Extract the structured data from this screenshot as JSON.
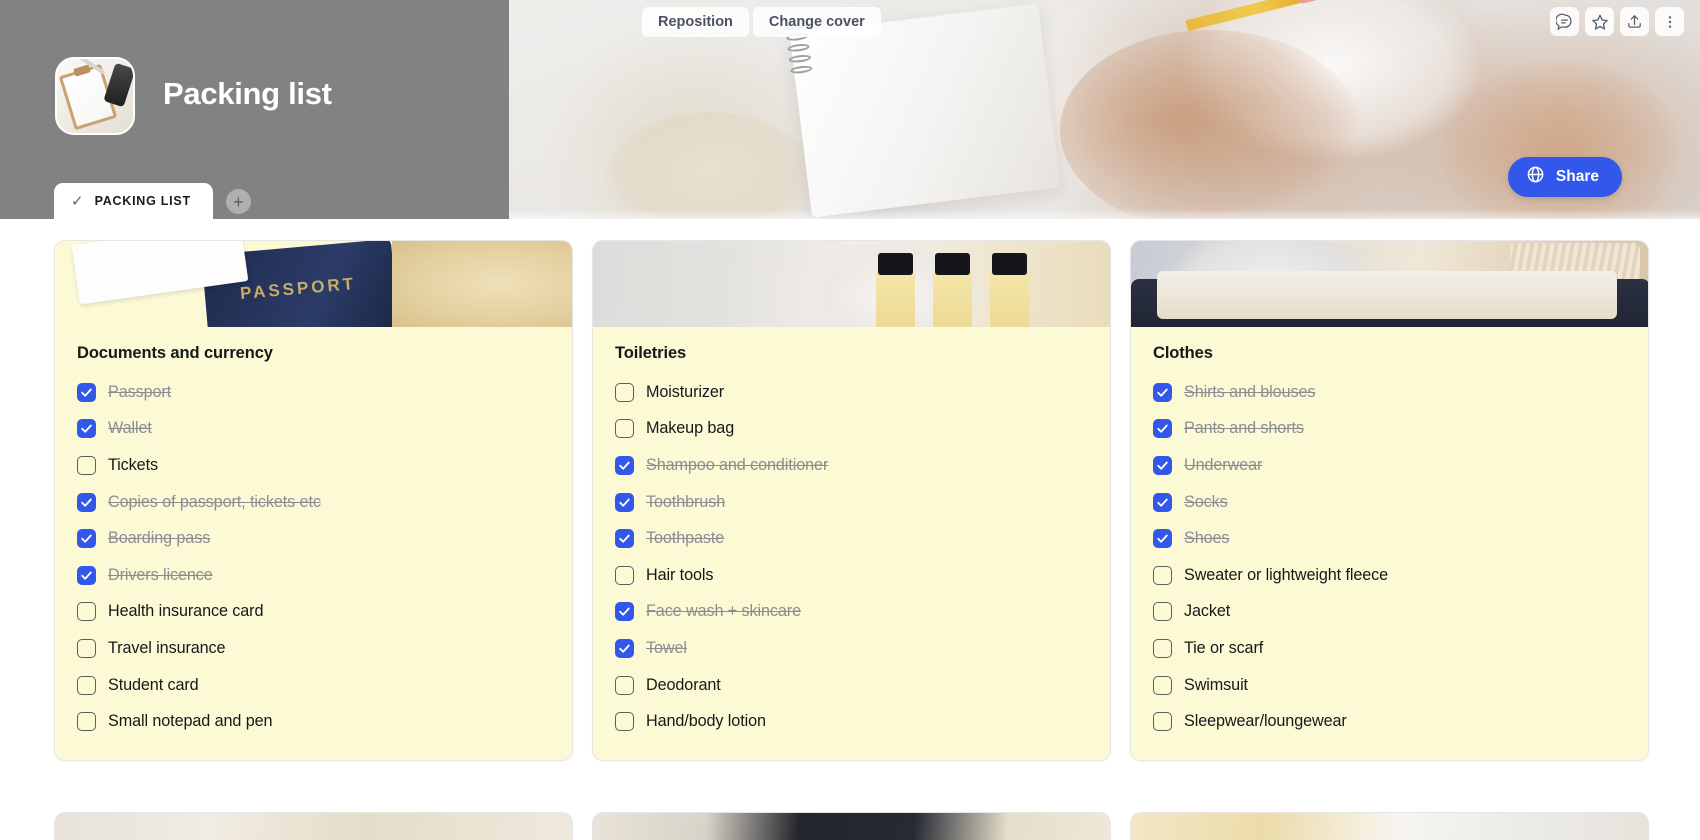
{
  "header": {
    "title": "Packing list",
    "doc_icon": "clipboard-photo-icon",
    "reposition_label": "Reposition",
    "change_cover_label": "Change cover",
    "icons": [
      {
        "name": "comment-icon",
        "title": "Comment"
      },
      {
        "name": "star-icon",
        "title": "Favorite"
      },
      {
        "name": "share-upload-icon",
        "title": "Export"
      },
      {
        "name": "more-options-icon",
        "title": "More"
      }
    ],
    "tabs": [
      {
        "label": "PACKING LIST",
        "check": "✓",
        "active": true
      }
    ],
    "add_tab_label": "+",
    "share": {
      "label": "Share",
      "icon": "globe-icon",
      "color": "#3257eb"
    }
  },
  "theme": {
    "card_background": "#fbfad4",
    "checkbox_checked": "#3257eb",
    "checked_text": "#8b8d93",
    "text": "#16181c",
    "cover_left_panel": "#828282"
  },
  "board": {
    "columns": [
      {
        "card_image": "passport-map-documents-photo",
        "title": "Documents and currency",
        "items": [
          {
            "label": "Passport",
            "checked": true
          },
          {
            "label": "Wallet",
            "checked": true
          },
          {
            "label": "Tickets",
            "checked": false
          },
          {
            "label": "Copies of passport, tickets etc",
            "checked": true
          },
          {
            "label": "Boarding pass",
            "checked": true
          },
          {
            "label": "Drivers licence",
            "checked": true
          },
          {
            "label": "Health insurance card",
            "checked": false
          },
          {
            "label": "Travel insurance",
            "checked": false
          },
          {
            "label": "Student card",
            "checked": false
          },
          {
            "label": "Small notepad and pen",
            "checked": false
          }
        ]
      },
      {
        "card_image": "towel-toiletry-bottles-photo",
        "title": "Toiletries",
        "items": [
          {
            "label": "Moisturizer",
            "checked": false
          },
          {
            "label": "Makeup bag",
            "checked": false
          },
          {
            "label": "Shampoo and conditioner",
            "checked": true
          },
          {
            "label": "Toothbrush",
            "checked": true
          },
          {
            "label": "Toothpaste",
            "checked": true
          },
          {
            "label": "Hair tools",
            "checked": false
          },
          {
            "label": "Face wash + skincare",
            "checked": true
          },
          {
            "label": "Towel",
            "checked": true
          },
          {
            "label": "Deodorant",
            "checked": false
          },
          {
            "label": "Hand/body lotion",
            "checked": false
          }
        ]
      },
      {
        "card_image": "packed-suitcase-clothes-photo",
        "title": "Clothes",
        "items": [
          {
            "label": "Shirts and blouses",
            "checked": true
          },
          {
            "label": "Pants and shorts",
            "checked": true
          },
          {
            "label": "Underwear",
            "checked": true
          },
          {
            "label": "Socks",
            "checked": true
          },
          {
            "label": "Shoes",
            "checked": true
          },
          {
            "label": "Sweater or lightweight fleece",
            "checked": false
          },
          {
            "label": "Jacket",
            "checked": false
          },
          {
            "label": "Tie or scarf",
            "checked": false
          },
          {
            "label": "Swimsuit",
            "checked": false
          },
          {
            "label": "Sleepwear/loungewear",
            "checked": false
          }
        ]
      }
    ],
    "next_row_cards": [
      {
        "card_image": "hanging-clothes-rack-photo"
      },
      {
        "card_image": "electronics-keyboard-photo"
      },
      {
        "card_image": "sunhat-sunglasses-photo"
      }
    ]
  }
}
